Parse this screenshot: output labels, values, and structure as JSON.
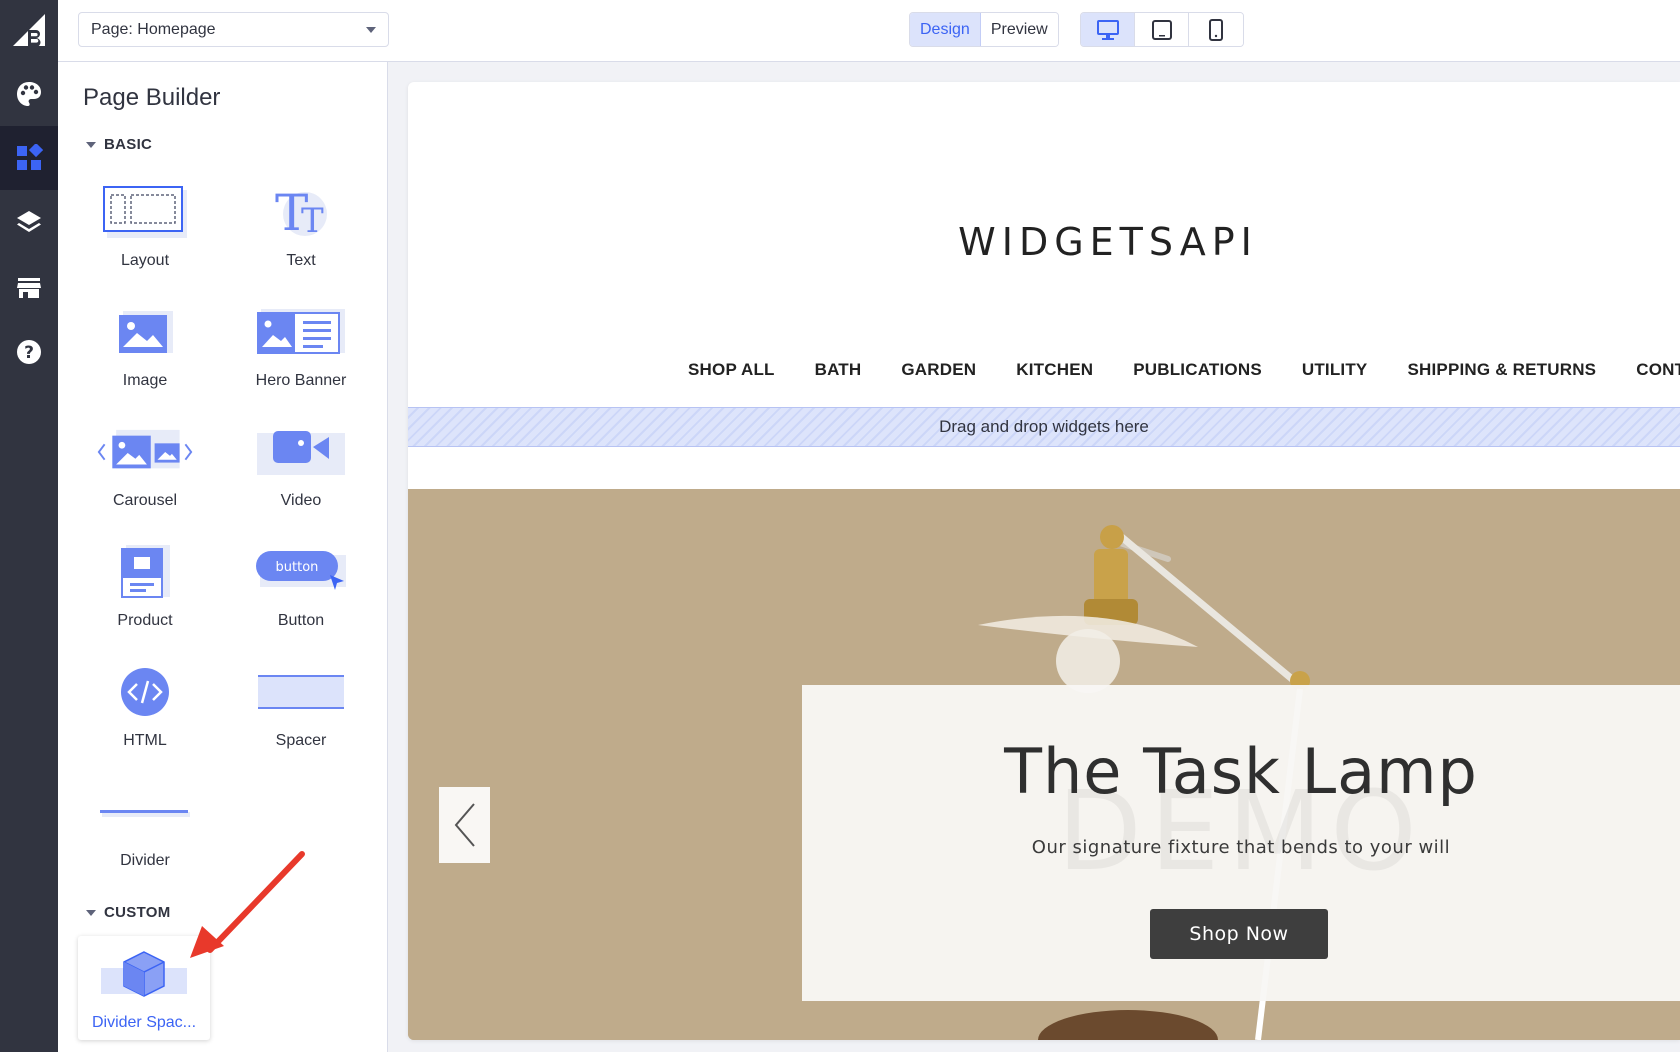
{
  "topbar": {
    "page_select": "Page: Homepage",
    "modes": {
      "design": "Design",
      "preview": "Preview"
    }
  },
  "panel": {
    "title": "Page Builder",
    "basic_section": "BASIC",
    "custom_section": "CUSTOM",
    "widgets": [
      {
        "label": "Layout",
        "icon": "layout-icon"
      },
      {
        "label": "Text",
        "icon": "text-icon"
      },
      {
        "label": "Image",
        "icon": "image-icon"
      },
      {
        "label": "Hero Banner",
        "icon": "hero-banner-icon"
      },
      {
        "label": "Carousel",
        "icon": "carousel-icon"
      },
      {
        "label": "Video",
        "icon": "video-icon"
      },
      {
        "label": "Product",
        "icon": "product-icon"
      },
      {
        "label": "Button",
        "icon": "button-icon"
      },
      {
        "label": "HTML",
        "icon": "html-icon"
      },
      {
        "label": "Spacer",
        "icon": "spacer-icon"
      },
      {
        "label": "Divider",
        "icon": "divider-icon"
      }
    ],
    "button_icon_text": "button",
    "custom_widget": "Divider Spac..."
  },
  "canvas": {
    "store_name": "WIDGETSAPI",
    "nav": [
      "SHOP ALL",
      "BATH",
      "GARDEN",
      "KITCHEN",
      "PUBLICATIONS",
      "UTILITY",
      "SHIPPING & RETURNS",
      "CONTACT"
    ],
    "dropzone": "Drag and drop widgets here",
    "hero": {
      "title": "The Task Lamp",
      "watermark": "DEMO",
      "subtitle": "Our signature fixture that bends to your will",
      "button": "Shop Now"
    }
  },
  "colors": {
    "rail": "#313440",
    "accent": "#3c64f4",
    "hero_bg": "#bfab8b",
    "annotation_arrow": "#e8392b"
  }
}
